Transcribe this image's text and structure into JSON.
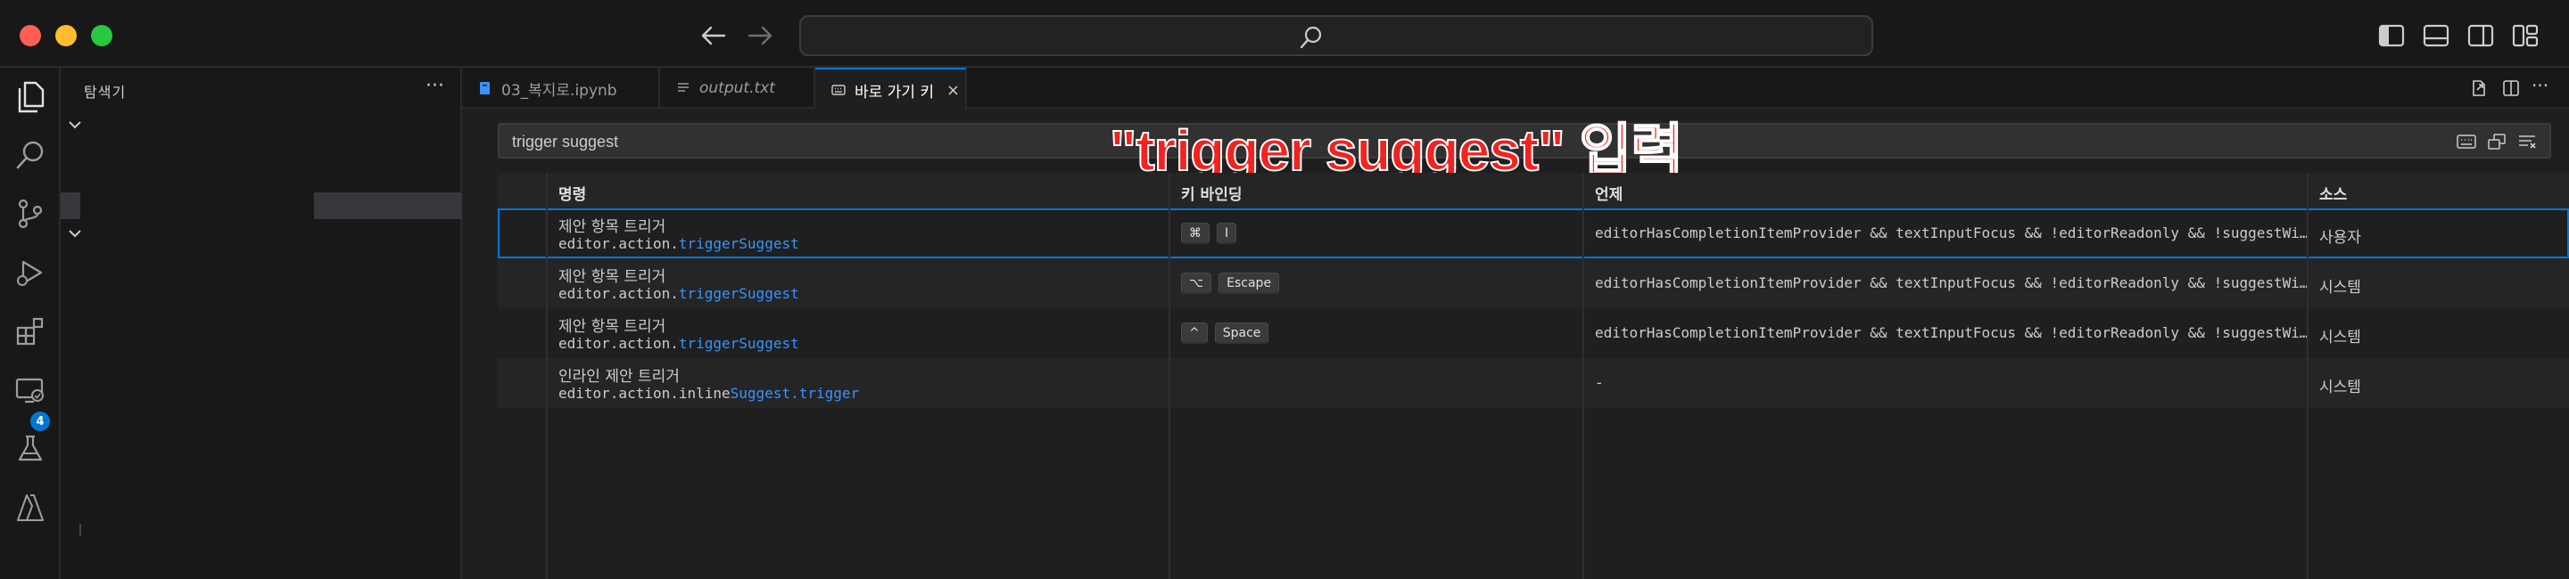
{
  "titlebar": {
    "search_placeholder": "",
    "icons": [
      "back-arrow-icon",
      "forward-arrow-icon",
      "search-icon",
      "toggle-primary-sidebar-icon",
      "toggle-panel-icon",
      "toggle-secondary-sidebar-icon",
      "customize-layout-icon"
    ]
  },
  "activity_bar": {
    "items": [
      {
        "name": "explorer-icon"
      },
      {
        "name": "search-icon"
      },
      {
        "name": "source-control-icon"
      },
      {
        "name": "run-debug-icon"
      },
      {
        "name": "extensions-icon",
        "badge": "4"
      },
      {
        "name": "remote-explorer-icon"
      },
      {
        "name": "testing-icon"
      },
      {
        "name": "azure-icon"
      }
    ]
  },
  "sidebar": {
    "title": "탐색기",
    "more": "···"
  },
  "tabs": [
    {
      "label": "03_복지로.ipynb",
      "icon": "notebook-icon"
    },
    {
      "label": "output.txt",
      "icon": "text-file-icon"
    },
    {
      "label": "바로 가기 키",
      "icon": "keyboard-icon",
      "close": "×"
    }
  ],
  "keybindings": {
    "search_value": "trigger suggest",
    "annotation": "\"trigger suggest\" 입력",
    "columns": {
      "command": "명령",
      "keybinding": "키 바인딩",
      "when": "언제",
      "source": "소스"
    },
    "rows": [
      {
        "title": "제안 항목 트리거",
        "id_prefix": "editor.action.",
        "id_highlight": "triggerSuggest",
        "id_rest": "",
        "keys": [
          "⌘",
          "I"
        ],
        "when": "editorHasCompletionItemProvider && textInputFocus && !editorReadonly && !suggestWidgetVisible",
        "source": "사용자"
      },
      {
        "title": "제안 항목 트리거",
        "id_prefix": "editor.action.",
        "id_highlight": "triggerSuggest",
        "id_rest": "",
        "keys": [
          "⌥",
          "Escape"
        ],
        "when": "editorHasCompletionItemProvider && textInputFocus && !editorReadonly && !suggestWidgetVisible",
        "source": "시스템"
      },
      {
        "title": "제안 항목 트리거",
        "id_prefix": "editor.action.",
        "id_highlight": "triggerSuggest",
        "id_rest": "",
        "keys": [
          "^",
          "Space"
        ],
        "when": "editorHasCompletionItemProvider && textInputFocus && !editorReadonly && !suggestWidgetVisible",
        "source": "시스템"
      },
      {
        "title": "인라인 제안 트리거",
        "id_prefix": "editor.action.inline",
        "id_highlight": "Suggest",
        "id_dot": ".",
        "id_highlight2": "trigger",
        "keys": [],
        "when": "-",
        "source": "시스템"
      }
    ]
  },
  "colors": {
    "accent": "#0078d4",
    "annotation": "#f2231f",
    "highlight": "#3794ff"
  }
}
